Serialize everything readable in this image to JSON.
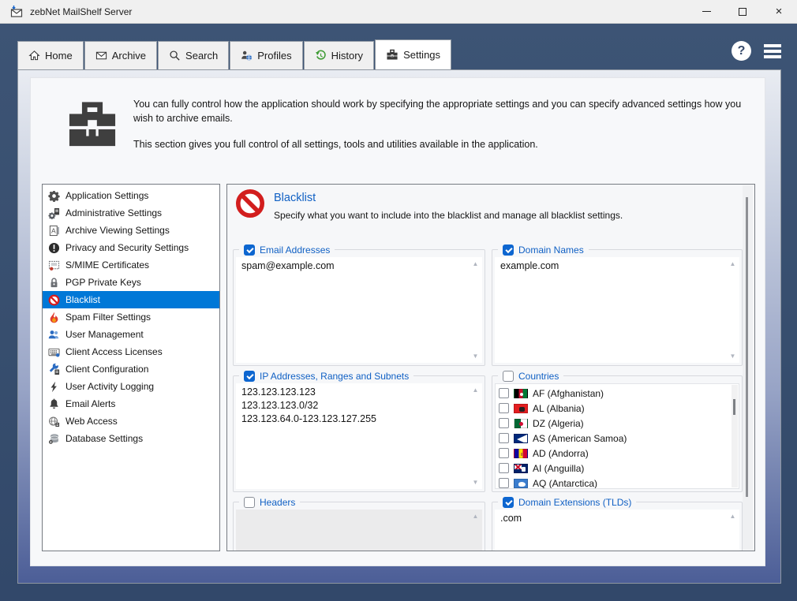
{
  "window": {
    "title": "zebNet MailShelf Server",
    "controls": {
      "minimize": "minimize",
      "maximize": "maximize",
      "close": "close"
    }
  },
  "toolbar": {
    "tabs": [
      {
        "label": "Home",
        "icon": "home-icon"
      },
      {
        "label": "Archive",
        "icon": "envelope-icon"
      },
      {
        "label": "Search",
        "icon": "magnifier-icon"
      },
      {
        "label": "Profiles",
        "icon": "person-globe-icon"
      },
      {
        "label": "History",
        "icon": "history-arrow-icon"
      },
      {
        "label": "Settings",
        "icon": "toolbox-icon",
        "active": true
      }
    ],
    "help_icon": "?",
    "accent_dark_blue": "#374e6e"
  },
  "intro": {
    "line1": "You can fully control how the application should work by specifying the appropriate settings and you can specify advanced settings how you wish to archive emails.",
    "line2": "This section gives you full control of all settings, tools and utilities available in the application."
  },
  "sidebar": {
    "items": [
      {
        "label": "Application Settings",
        "icon": "gear-icon"
      },
      {
        "label": "Administrative Settings",
        "icon": "gear-document-icon"
      },
      {
        "label": "Archive Viewing Settings",
        "icon": "document-a-icon"
      },
      {
        "label": "Privacy and Security Settings",
        "icon": "exclamation-circle-icon"
      },
      {
        "label": "S/MIME Certificates",
        "icon": "certificate-icon"
      },
      {
        "label": "PGP Private Keys",
        "icon": "padlock-icon"
      },
      {
        "label": "Blacklist",
        "icon": "no-entry-icon",
        "selected": true
      },
      {
        "label": "Spam Filter Settings",
        "icon": "flame-icon"
      },
      {
        "label": "User Management",
        "icon": "users-icon"
      },
      {
        "label": "Client Access Licenses",
        "icon": "keyboard-icon"
      },
      {
        "label": "Client Configuration",
        "icon": "wrench-icon"
      },
      {
        "label": "User Activity Logging",
        "icon": "lightning-icon"
      },
      {
        "label": "Email Alerts",
        "icon": "bell-icon"
      },
      {
        "label": "Web Access",
        "icon": "globe-icon"
      },
      {
        "label": "Database Settings",
        "icon": "database-icon"
      }
    ]
  },
  "blacklist": {
    "title": "Blacklist",
    "description": "Specify what you want to include into the blacklist and manage all blacklist settings.",
    "title_color": "#1060c4",
    "selection_color": "#0078d7",
    "groups": {
      "email_addresses": {
        "label": "Email Addresses",
        "checked": true,
        "value": "spam@example.com"
      },
      "domain_names": {
        "label": "Domain Names",
        "checked": true,
        "value": "example.com"
      },
      "ip_addresses": {
        "label": "IP Addresses, Ranges and Subnets",
        "checked": true,
        "value": "123.123.123.123\n123.123.123.0/32\n123.123.64.0-123.123.127.255"
      },
      "countries": {
        "label": "Countries",
        "checked": false,
        "items": [
          {
            "code": "AF",
            "label": "AF (Afghanistan)",
            "checked": false
          },
          {
            "code": "AL",
            "label": "AL (Albania)",
            "checked": false
          },
          {
            "code": "DZ",
            "label": "DZ (Algeria)",
            "checked": false
          },
          {
            "code": "AS",
            "label": "AS (American Samoa)",
            "checked": false
          },
          {
            "code": "AD",
            "label": "AD (Andorra)",
            "checked": false
          },
          {
            "code": "AI",
            "label": "AI (Anguilla)",
            "checked": false
          },
          {
            "code": "AQ",
            "label": "AQ (Antarctica)",
            "checked": false
          }
        ]
      },
      "headers": {
        "label": "Headers",
        "checked": false,
        "value": "",
        "disabled": true
      },
      "domain_extensions": {
        "label": "Domain Extensions (TLDs)",
        "checked": true,
        "value": ".com"
      }
    }
  }
}
